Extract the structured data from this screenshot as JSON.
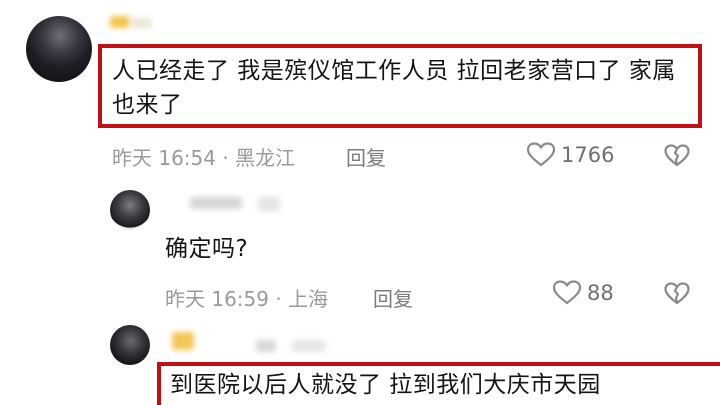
{
  "comments": [
    {
      "text": "人已经走了 我是殡仪馆工作人员 拉回老家营口了 家属也来了",
      "time": "昨天 16:54",
      "location": "黑龙江",
      "reply_label": "回复",
      "likes": "1766",
      "icons": [
        "heart-icon",
        "broken-heart-icon"
      ]
    },
    {
      "text": "确定吗?",
      "time": "昨天 16:59",
      "location": "上海",
      "reply_label": "回复",
      "likes": "88",
      "icons": [
        "heart-icon",
        "broken-heart-icon"
      ]
    },
    {
      "text": "到医院以后人就没了 拉到我们大庆市天园"
    }
  ],
  "colors": {
    "highlight_border": "#c10f12",
    "meta_text": "#9a9a9a",
    "icon": "#8a8a8a"
  }
}
